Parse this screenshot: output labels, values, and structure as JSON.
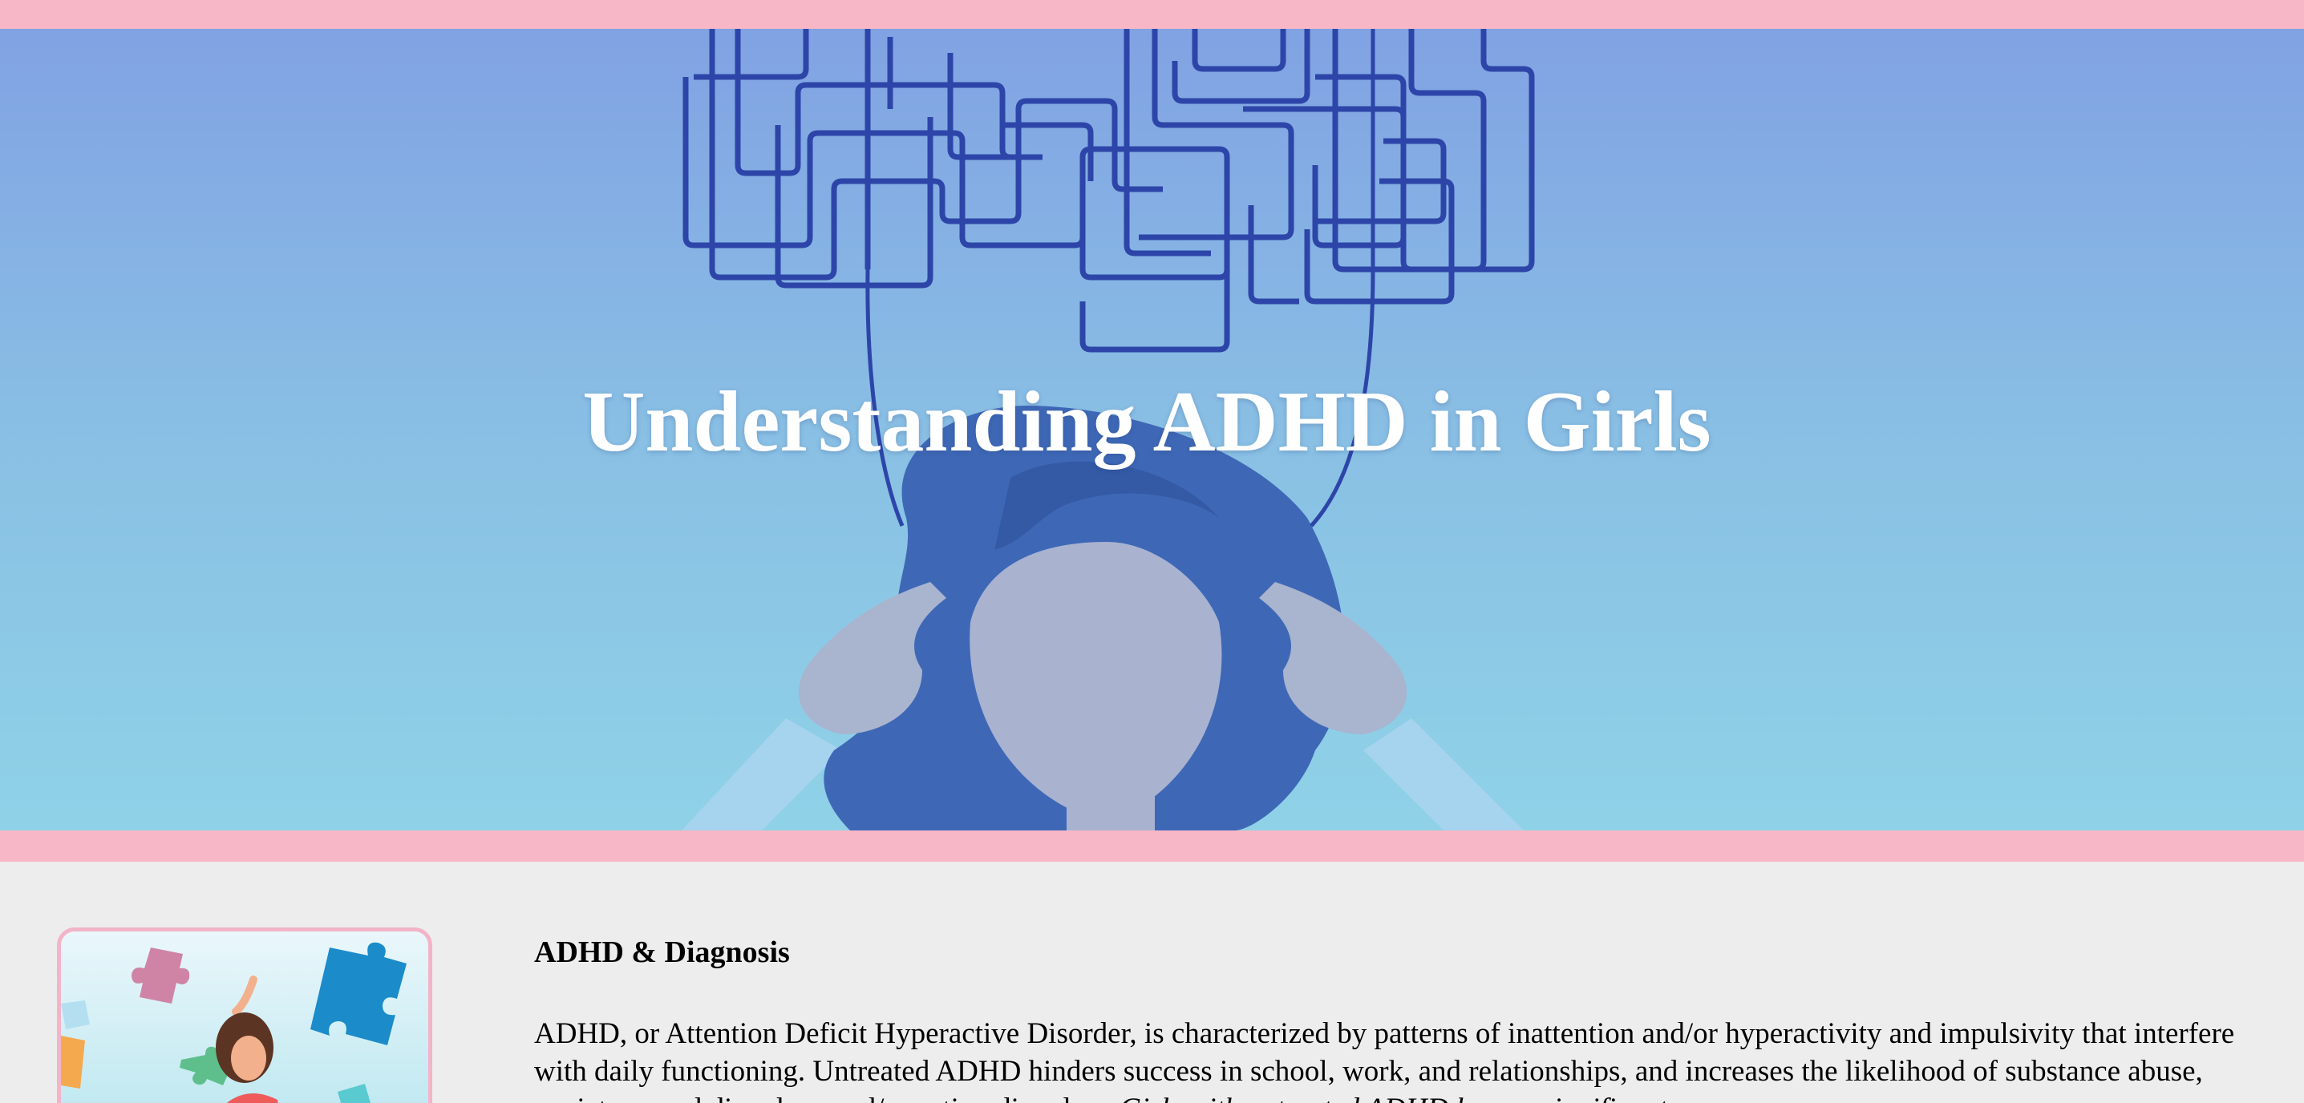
{
  "hero": {
    "title": "Understanding ADHD in Girls",
    "illustration": "girl-with-tangled-thoughts",
    "colors": {
      "band": "#f7b7c6",
      "gradient_top": "#81a2e3",
      "gradient_bottom": "#8fd2e7",
      "maze_line": "#2d45a8",
      "hair": "#3d67b5"
    }
  },
  "section": {
    "image": "girl-with-puzzle-pieces",
    "title": "ADHD & Diagnosis",
    "paragraph_part1": "ADHD, or Attention Deficit Hyperactive Disorder, is characterized by patterns of inattention and/or hyperactivity and impulsivity that interfere with daily functioning. Untreated ADHD hinders success in school, work, and relationships, and increases the likelihood of substance abuse, anxiety, mood disorders, and/or eating disorders.",
    "paragraph_italic": "Girls with untreated ADHD have a significant"
  }
}
